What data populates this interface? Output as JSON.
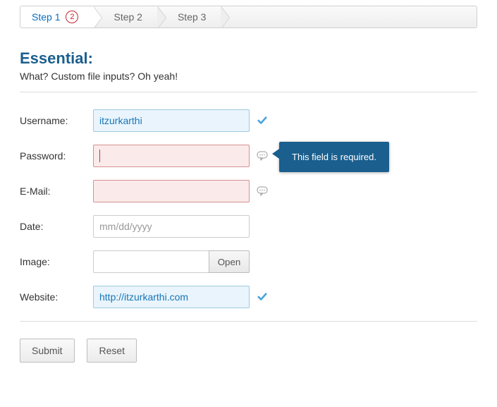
{
  "wizard": {
    "steps": [
      {
        "label": "Step 1",
        "badge": "2"
      },
      {
        "label": "Step 2"
      },
      {
        "label": "Step 3"
      }
    ]
  },
  "section": {
    "title": "Essential:",
    "subtitle": "What? Custom file inputs? Oh yeah!"
  },
  "labels": {
    "username": "Username:",
    "password": "Password:",
    "email": "E-Mail:",
    "date": "Date:",
    "image": "Image:",
    "website": "Website:"
  },
  "values": {
    "username": "itzurkarthi",
    "password": "",
    "email": "",
    "date_placeholder": "mm/dd/yyyy",
    "website": "http://itzurkarthi.com"
  },
  "file": {
    "open_label": "Open"
  },
  "tooltip": {
    "required": "This field is required."
  },
  "buttons": {
    "submit": "Submit",
    "reset": "Reset"
  },
  "colors": {
    "accent": "#1a5f8e",
    "error_border": "#d69191",
    "valid_border": "#9ecae1"
  }
}
